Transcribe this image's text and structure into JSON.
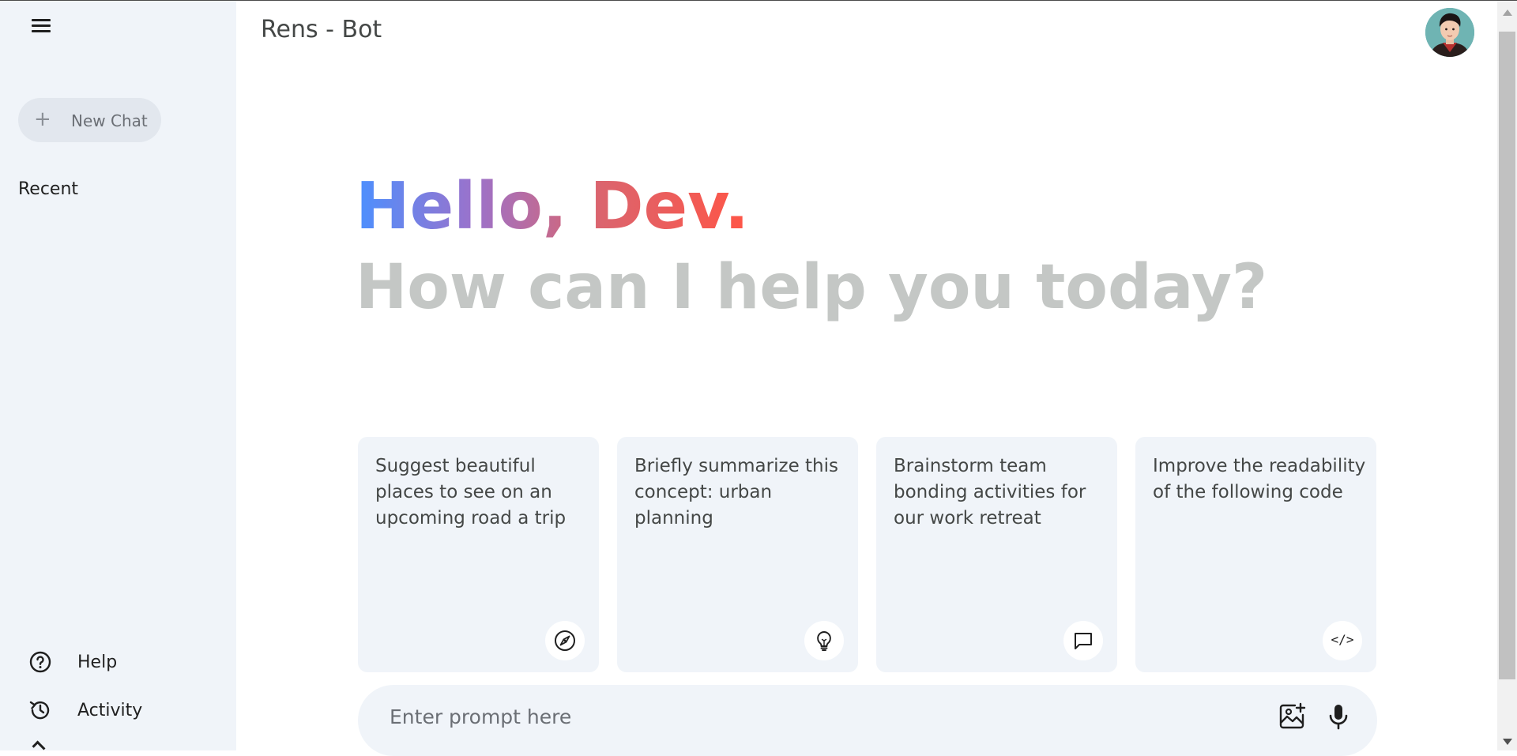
{
  "app": {
    "title": "Rens - Bot"
  },
  "sidebar": {
    "new_chat_label": "New Chat",
    "recent_label": "Recent",
    "links": [
      {
        "label": "Help",
        "icon": "help-circle-icon"
      },
      {
        "label": "Activity",
        "icon": "history-icon"
      }
    ]
  },
  "greeting": {
    "hello": "Hello, Dev.",
    "subtitle": "How can I help you today?"
  },
  "cards": [
    {
      "text": "Suggest beautiful places to see on an upcoming road a trip",
      "icon": "compass-icon"
    },
    {
      "text": "Briefly summarize this concept: urban planning",
      "icon": "lightbulb-icon"
    },
    {
      "text": "Brainstorm team bonding activities for our work retreat",
      "icon": "message-icon"
    },
    {
      "text": "Improve the readability of the following code",
      "icon": "code-icon",
      "glyph": "</>"
    }
  ],
  "prompt": {
    "placeholder": "Enter prompt here",
    "value": ""
  },
  "colors": {
    "sidebar_bg": "#f0f4f9",
    "gradient": [
      "#4b90ff",
      "#9b72cb",
      "#d96570",
      "#ff5546"
    ],
    "subtitle": "#c4c7c5"
  }
}
